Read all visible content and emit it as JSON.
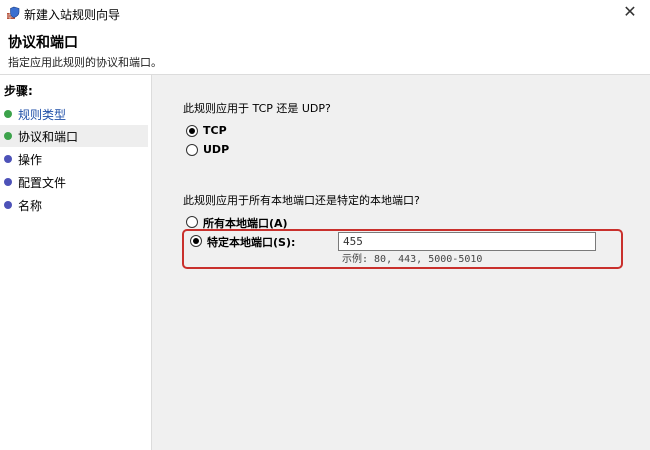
{
  "window": {
    "title": "新建入站规则向导",
    "close_glyph": "✕"
  },
  "header": {
    "title": "协议和端口",
    "description": "指定应用此规则的协议和端口。"
  },
  "sidebar": {
    "steps_label": "步骤:",
    "items": [
      {
        "label": "规则类型",
        "state": "done"
      },
      {
        "label": "协议和端口",
        "state": "current"
      },
      {
        "label": "操作",
        "state": "pending"
      },
      {
        "label": "配置文件",
        "state": "pending"
      },
      {
        "label": "名称",
        "state": "pending"
      }
    ]
  },
  "protocol": {
    "question": "此规则应用于 TCP 还是 UDP?",
    "options": [
      {
        "label": "TCP",
        "checked": true
      },
      {
        "label": "UDP",
        "checked": false
      }
    ]
  },
  "ports": {
    "question": "此规则应用于所有本地端口还是特定的本地端口?",
    "options": [
      {
        "label": "所有本地端口(A)",
        "checked": false
      },
      {
        "label": "特定本地端口(S):",
        "checked": true
      }
    ],
    "value": "455",
    "example": "示例: 80, 443, 5000-5010"
  },
  "colors": {
    "highlight": "#c9302c",
    "done_dot": "#3ba24a",
    "pending_dot": "#4d52b8",
    "link_text": "#1f4fa8"
  },
  "icons": {
    "app": "firewall-shield-icon",
    "close": "close-icon"
  }
}
